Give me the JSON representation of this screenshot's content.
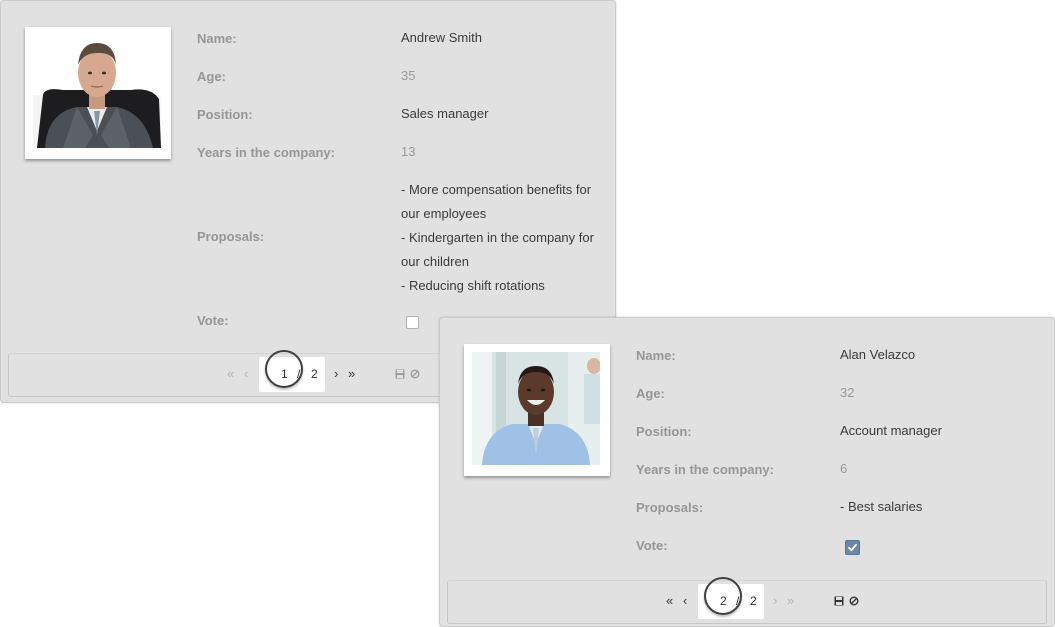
{
  "records": [
    {
      "labels": {
        "name": "Name:",
        "age": "Age:",
        "position": "Position:",
        "years": "Years in the company:",
        "proposals": "Proposals:",
        "vote": "Vote:"
      },
      "name": "Andrew Smith",
      "age": "35",
      "position": "Sales manager",
      "years": "13",
      "proposals": [
        "- More compensation benefits for our employees",
        "- Kindergarten in the company for our children",
        "- Reducing shift rotations"
      ],
      "vote": false,
      "pager": {
        "first": "«",
        "prev": "‹",
        "current": "1",
        "separator": "/",
        "total": "2",
        "next": "›",
        "last": "»",
        "icons": [
          "save-icon",
          "cancel-icon"
        ]
      }
    },
    {
      "labels": {
        "name": "Name:",
        "age": "Age:",
        "position": "Position:",
        "years": "Years in the company:",
        "proposals": "Proposals:",
        "vote": "Vote:"
      },
      "name": "Alan Velazco",
      "age": "32",
      "position": "Account manager",
      "years": "6",
      "proposals": [
        "- Best salaries"
      ],
      "vote": true,
      "pager": {
        "first": "«",
        "prev": "‹",
        "current": "2",
        "separator": "/",
        "total": "2",
        "next": "›",
        "last": "»",
        "icons": [
          "save-icon",
          "cancel-icon"
        ]
      }
    }
  ],
  "colors": {
    "card_bg": "#e1e1e1",
    "label": "#969696",
    "value": "#3a3a3a",
    "checkbox_checked": "#6e87a5",
    "pager_disabled": "#b3b3b3",
    "pager_active": "#333333"
  }
}
